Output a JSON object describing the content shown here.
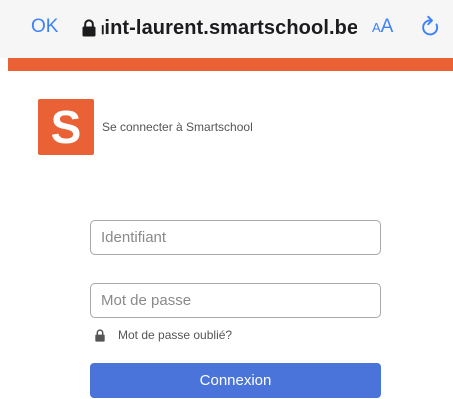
{
  "browser": {
    "done_label": "OK",
    "url": "ₗint-laurent.smartschool.be",
    "reader_small": "A",
    "reader_big": "A",
    "accent_color": "#ea6136",
    "link_color": "#3e82f7"
  },
  "brand": {
    "logo_letter": "S",
    "logo_color": "#ea6136",
    "title": "Se connecter à Smartschool"
  },
  "form": {
    "username_placeholder": "Identifiant",
    "username_value": "",
    "password_placeholder": "Mot de passe",
    "password_value": "",
    "forgot_label": "Mot de passe oublié?",
    "submit_label": "Connexion",
    "submit_color": "#4a74d9"
  },
  "icons": {
    "address_lock": "lock-icon",
    "reload": "reload-icon",
    "forgot_lock": "lock-icon"
  }
}
